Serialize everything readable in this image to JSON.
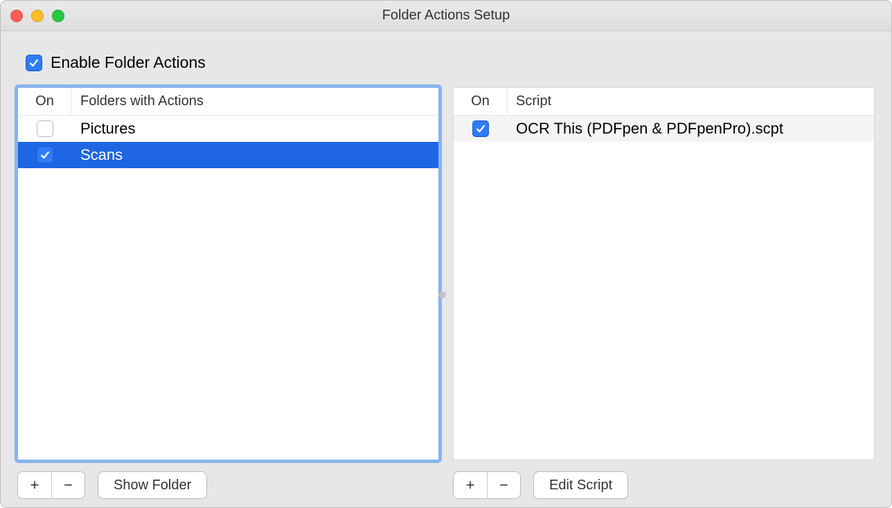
{
  "window": {
    "title": "Folder Actions Setup"
  },
  "enable": {
    "label": "Enable Folder Actions",
    "checked": true
  },
  "folders_panel": {
    "header": {
      "on": "On",
      "name": "Folders with Actions"
    },
    "rows": [
      {
        "on": false,
        "name": "Pictures",
        "selected": false
      },
      {
        "on": true,
        "name": "Scans",
        "selected": true
      }
    ],
    "add_glyph": "+",
    "remove_glyph": "−",
    "action_button": "Show Folder"
  },
  "scripts_panel": {
    "header": {
      "on": "On",
      "name": "Script"
    },
    "rows": [
      {
        "on": true,
        "name": "OCR This (PDFpen & PDFpenPro).scpt",
        "selected": false,
        "striped": true
      }
    ],
    "add_glyph": "+",
    "remove_glyph": "−",
    "action_button": "Edit Script"
  }
}
